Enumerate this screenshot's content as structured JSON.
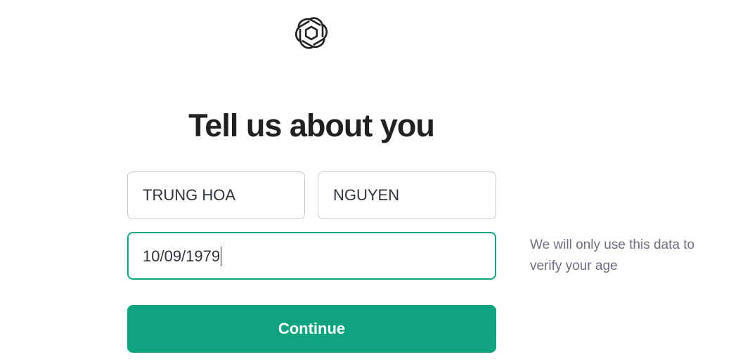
{
  "logo": {
    "icon": "openai-logo-icon",
    "color": "#202123"
  },
  "heading": {
    "title": "Tell us about you"
  },
  "form": {
    "first_name": {
      "value": "TRUNG HOA"
    },
    "last_name": {
      "value": "NGUYEN"
    },
    "birthday": {
      "value": "10/09/1979",
      "focused": true
    },
    "hint": "We will only use this data to verify your age",
    "continue_label": "Continue"
  },
  "colors": {
    "accent": "#10a37f",
    "heading_text": "#202123",
    "field_border": "#c2c8d0",
    "hint_text": "#6e6e80"
  }
}
